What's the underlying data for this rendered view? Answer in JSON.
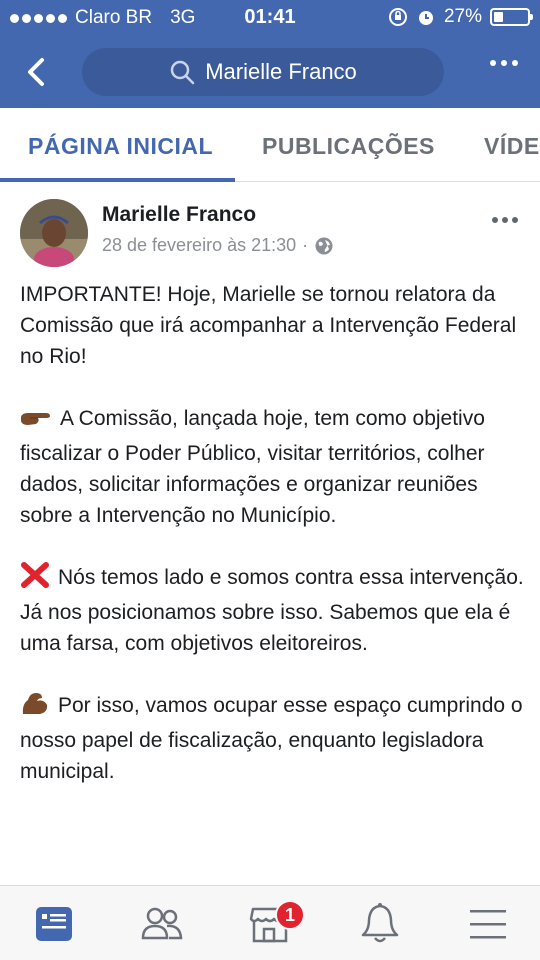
{
  "status": {
    "carrier": "Claro BR",
    "network": "3G",
    "time": "01:41",
    "battery": "27%",
    "battery_level": 0.27
  },
  "header": {
    "search_text": "Marielle Franco",
    "icons": [
      "back-icon",
      "search-icon",
      "more-icon"
    ]
  },
  "tabs": [
    {
      "label": "PÁGINA INICIAL",
      "active": true
    },
    {
      "label": "PUBLICAÇÕES",
      "active": false
    },
    {
      "label": "VÍDE",
      "active": false
    }
  ],
  "post": {
    "author": "Marielle Franco",
    "timestamp": "28 de fevereiro às 21:30",
    "separator": "·",
    "privacy_icon": "globe-icon",
    "paragraphs": [
      {
        "emoji": "",
        "text": "IMPORTANTE! Hoje, Marielle se tornou relatora da Comissão que irá acompanhar a Intervenção Federal no Rio!"
      },
      {
        "emoji": "pointing-hand-icon",
        "text": "A Comissão, lançada hoje, tem como objetivo fiscalizar o Poder Público, visitar territórios, colher dados, solicitar informações e organizar reuniões sobre a Intervenção no Município."
      },
      {
        "emoji": "cross-mark-icon",
        "text": "Nós temos lado e somos contra essa intervenção. Já nos posicionamos sobre isso. Sabemos que ela é uma farsa, com objetivos eleitoreiros."
      },
      {
        "emoji": "flexed-biceps-icon",
        "text": "Por isso, vamos ocupar esse espaço cumprindo o nosso papel de fiscalização, enquanto legisladora municipal."
      }
    ]
  },
  "bottom_nav": {
    "items": [
      "news-feed-icon",
      "friends-icon",
      "marketplace-icon",
      "notifications-icon",
      "menu-icon"
    ],
    "marketplace_badge": "1"
  },
  "colors": {
    "brand": "#4468b0",
    "badge": "#e0232f"
  }
}
